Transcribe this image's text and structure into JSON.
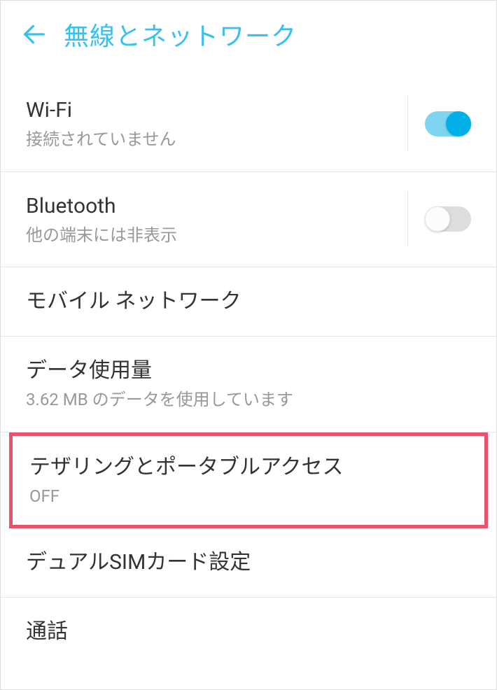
{
  "header": {
    "title": "無線とネットワーク"
  },
  "settings": {
    "wifi": {
      "title": "Wi-Fi",
      "subtitle": "接続されていません",
      "toggle": true
    },
    "bluetooth": {
      "title": "Bluetooth",
      "subtitle": "他の端末には非表示",
      "toggle": false
    },
    "mobile_network": {
      "title": "モバイル ネットワーク"
    },
    "data_usage": {
      "title": "データ使用量",
      "subtitle": "3.62 MB のデータを使用しています"
    },
    "tethering": {
      "title": "テザリングとポータブルアクセス",
      "subtitle": "OFF"
    },
    "dual_sim": {
      "title": "デュアルSIMカード設定"
    },
    "call": {
      "title": "通話"
    }
  }
}
